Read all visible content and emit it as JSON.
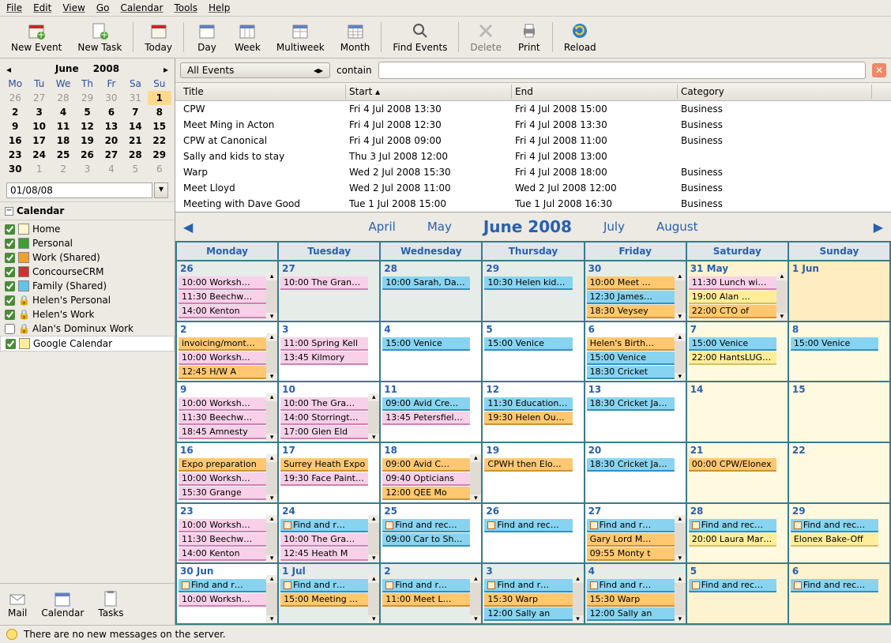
{
  "menu": [
    "File",
    "Edit",
    "View",
    "Go",
    "Calendar",
    "Tools",
    "Help"
  ],
  "toolbar": [
    {
      "id": "new-event",
      "label": "New Event"
    },
    {
      "id": "new-task",
      "label": "New Task"
    },
    {
      "sep": true
    },
    {
      "id": "today",
      "label": "Today"
    },
    {
      "sep": true
    },
    {
      "id": "day",
      "label": "Day"
    },
    {
      "id": "week",
      "label": "Week"
    },
    {
      "id": "multiweek",
      "label": "Multiweek"
    },
    {
      "id": "month",
      "label": "Month"
    },
    {
      "sep": true
    },
    {
      "id": "find-events",
      "label": "Find Events"
    },
    {
      "sep": true
    },
    {
      "id": "delete",
      "label": "Delete",
      "disabled": true
    },
    {
      "id": "print",
      "label": "Print"
    },
    {
      "sep": true
    },
    {
      "id": "reload",
      "label": "Reload"
    }
  ],
  "minical": {
    "month": "June",
    "year": "2008",
    "dow": [
      "Mo",
      "Tu",
      "We",
      "Th",
      "Fr",
      "Sa",
      "Su"
    ],
    "days": [
      [
        26,
        1
      ],
      [
        27,
        1
      ],
      [
        28,
        1
      ],
      [
        29,
        1
      ],
      [
        30,
        1
      ],
      [
        31,
        1
      ],
      [
        1,
        2
      ],
      [
        2,
        0
      ],
      [
        3,
        0
      ],
      [
        4,
        0
      ],
      [
        5,
        0
      ],
      [
        6,
        0
      ],
      [
        7,
        0
      ],
      [
        8,
        0
      ],
      [
        9,
        0
      ],
      [
        10,
        0
      ],
      [
        11,
        0
      ],
      [
        12,
        0
      ],
      [
        13,
        0
      ],
      [
        14,
        0
      ],
      [
        15,
        0
      ],
      [
        16,
        0
      ],
      [
        17,
        0
      ],
      [
        18,
        0
      ],
      [
        19,
        0
      ],
      [
        20,
        0
      ],
      [
        21,
        0
      ],
      [
        22,
        0
      ],
      [
        23,
        0
      ],
      [
        24,
        0
      ],
      [
        25,
        0
      ],
      [
        26,
        0
      ],
      [
        27,
        0
      ],
      [
        28,
        0
      ],
      [
        29,
        0
      ],
      [
        30,
        0
      ],
      [
        1,
        1
      ],
      [
        2,
        1
      ],
      [
        3,
        1
      ],
      [
        4,
        1
      ],
      [
        5,
        1
      ],
      [
        6,
        1
      ]
    ],
    "date_input": "01/08/08"
  },
  "cal_section": "Calendar",
  "calendars": [
    {
      "name": "Home",
      "color": "#fff6cc",
      "checked": true
    },
    {
      "name": "Personal",
      "color": "#3aa030",
      "checked": true
    },
    {
      "name": "Work (Shared)",
      "color": "#f0a030",
      "checked": true
    },
    {
      "name": "ConcourseCRM",
      "color": "#d03030",
      "checked": true
    },
    {
      "name": "Family (Shared)",
      "color": "#60c4e8",
      "checked": true
    },
    {
      "name": "Helen's Personal",
      "color": "lock",
      "checked": true
    },
    {
      "name": "Helen's Work",
      "color": "lock",
      "checked": true
    },
    {
      "name": "Alan's Dominux Work",
      "color": "lock",
      "checked": false
    },
    {
      "name": "Google Calendar",
      "color": "#ffee99",
      "checked": true,
      "sel": true
    }
  ],
  "side_buttons": [
    "Mail",
    "Calendar",
    "Tasks"
  ],
  "search": {
    "combo": "All Events",
    "label": "contain",
    "value": ""
  },
  "list_head": [
    "Title",
    "Start",
    "End",
    "Category"
  ],
  "events": [
    {
      "t": "CPW",
      "s": "Fri 4 Jul 2008 13:30",
      "e": "Fri 4 Jul 2008 15:00",
      "c": "Business"
    },
    {
      "t": "Meet Ming in Acton",
      "s": "Fri 4 Jul 2008 12:30",
      "e": "Fri 4 Jul 2008 13:30",
      "c": "Business"
    },
    {
      "t": "CPW at Canonical",
      "s": "Fri 4 Jul 2008 09:00",
      "e": "Fri 4 Jul 2008 11:00",
      "c": "Business"
    },
    {
      "t": "Sally and kids to stay",
      "s": "Thu 3 Jul 2008 12:00",
      "e": "Fri 4 Jul 2008 13:00",
      "c": ""
    },
    {
      "t": "Warp",
      "s": "Wed 2 Jul 2008 15:30",
      "e": "Fri 4 Jul 2008 18:00",
      "c": "Business"
    },
    {
      "t": "Meet Lloyd",
      "s": "Wed 2 Jul 2008 11:00",
      "e": "Wed 2 Jul 2008 12:00",
      "c": "Business"
    },
    {
      "t": "Meeting with Dave Good",
      "s": "Tue 1 Jul 2008 15:00",
      "e": "Tue 1 Jul 2008 16:30",
      "c": "Business"
    }
  ],
  "nav_months": [
    "April",
    "May",
    "June 2008",
    "July",
    "August"
  ],
  "dow": [
    "Monday",
    "Tuesday",
    "Wednesday",
    "Thursday",
    "Friday",
    "Saturday",
    "Sunday"
  ],
  "grid": [
    [
      {
        "d": "26",
        "dim": 1,
        "sc": 1,
        "ev": [
          {
            "c": "pink",
            "t": "10:00 Worksh…"
          },
          {
            "c": "pink",
            "t": "11:30 Beechw…"
          },
          {
            "c": "pink",
            "t": "14:00 Kenton"
          }
        ]
      },
      {
        "d": "27",
        "dim": 1,
        "ev": [
          {
            "c": "pink",
            "t": "10:00 The Grang…"
          }
        ]
      },
      {
        "d": "28",
        "dim": 1,
        "ev": [
          {
            "c": "blue",
            "t": "10:00 Sarah, Dav…"
          }
        ]
      },
      {
        "d": "29",
        "dim": 1,
        "ev": [
          {
            "c": "blue",
            "t": "10:30 Helen kids …"
          }
        ]
      },
      {
        "d": "30",
        "dim": 1,
        "sc": 1,
        "ev": [
          {
            "c": "orange",
            "t": "10:00 Meet …"
          },
          {
            "c": "blue",
            "t": "12:30 James…"
          },
          {
            "c": "orange",
            "t": "18:30 Veysey"
          }
        ]
      },
      {
        "d": "31 May",
        "dim": 1,
        "we": 1,
        "sc": 1,
        "ev": [
          {
            "c": "pink",
            "t": "11:30 Lunch wi…"
          },
          {
            "c": "yellow",
            "t": "19:00 Alan …"
          },
          {
            "c": "orange",
            "t": "22:00 CTO of"
          }
        ]
      },
      {
        "d": "1 Jun",
        "we": 1,
        "today": 1,
        "ev": []
      }
    ],
    [
      {
        "d": "2",
        "sc": 1,
        "ev": [
          {
            "c": "orange",
            "t": "invoicing/mont…"
          },
          {
            "c": "pink",
            "t": "10:00 Worksh…"
          },
          {
            "c": "orange",
            "t": "12:45 H/W A"
          }
        ]
      },
      {
        "d": "3",
        "ev": [
          {
            "c": "pink",
            "t": "11:00 Spring Kell"
          },
          {
            "c": "pink",
            "t": "13:45 Kilmory"
          }
        ]
      },
      {
        "d": "4",
        "ev": [
          {
            "c": "blue",
            "t": "15:00 Venice"
          }
        ]
      },
      {
        "d": "5",
        "ev": [
          {
            "c": "blue",
            "t": "15:00 Venice"
          }
        ]
      },
      {
        "d": "6",
        "sc": 1,
        "ev": [
          {
            "c": "orange",
            "t": "Helen's Birth…"
          },
          {
            "c": "blue",
            "t": "15:00 Venice"
          },
          {
            "c": "blue",
            "t": "18:30 Cricket"
          }
        ]
      },
      {
        "d": "7",
        "we": 1,
        "ev": [
          {
            "c": "blue",
            "t": "15:00 Venice"
          },
          {
            "c": "yellow",
            "t": "22:00 HantsLUG …"
          }
        ]
      },
      {
        "d": "8",
        "we": 1,
        "ev": [
          {
            "c": "blue",
            "t": "15:00 Venice"
          }
        ]
      }
    ],
    [
      {
        "d": "9",
        "sc": 1,
        "ev": [
          {
            "c": "pink",
            "t": "10:00 Worksh…"
          },
          {
            "c": "pink",
            "t": "11:30 Beechw…"
          },
          {
            "c": "pink",
            "t": "18:45 Amnesty"
          }
        ]
      },
      {
        "d": "10",
        "sc": 1,
        "ev": [
          {
            "c": "pink",
            "t": "10:00 The Gra…"
          },
          {
            "c": "pink",
            "t": "14:00 Storringt…"
          },
          {
            "c": "pink",
            "t": "17:00 Glen Eld"
          }
        ]
      },
      {
        "d": "11",
        "ev": [
          {
            "c": "blue",
            "t": "09:00 Avid Cre…"
          },
          {
            "c": "pink",
            "t": "13:45 Petersfield…"
          }
        ]
      },
      {
        "d": "12",
        "ev": [
          {
            "c": "blue",
            "t": "11:30 Education …"
          },
          {
            "c": "orange",
            "t": "19:30 Helen Ou…"
          }
        ]
      },
      {
        "d": "13",
        "ev": [
          {
            "c": "blue",
            "t": "18:30 Cricket Ja…"
          }
        ]
      },
      {
        "d": "14",
        "we": 1,
        "ev": []
      },
      {
        "d": "15",
        "we": 1,
        "ev": []
      }
    ],
    [
      {
        "d": "16",
        "sc": 1,
        "ev": [
          {
            "c": "orange",
            "t": "Expo preparation"
          },
          {
            "c": "pink",
            "t": "10:00 Worksh…"
          },
          {
            "c": "pink",
            "t": "15:30 Grange"
          }
        ]
      },
      {
        "d": "17",
        "ev": [
          {
            "c": "orange",
            "t": "Surrey Heath Expo"
          },
          {
            "c": "pink",
            "t": "19:30 Face Paint…"
          }
        ]
      },
      {
        "d": "18",
        "sc": 1,
        "ev": [
          {
            "c": "orange",
            "t": "09:00 Avid C…"
          },
          {
            "c": "pink",
            "t": "09:40 Opticians"
          },
          {
            "c": "orange",
            "t": "12:00 QEE Mo"
          }
        ]
      },
      {
        "d": "19",
        "ev": [
          {
            "c": "orange",
            "t": "CPWH then Elo…"
          }
        ]
      },
      {
        "d": "20",
        "ev": [
          {
            "c": "blue",
            "t": "18:30 Cricket Ja…"
          }
        ]
      },
      {
        "d": "21",
        "we": 1,
        "ev": [
          {
            "c": "orange",
            "t": "00:00 CPW/Elonex"
          }
        ]
      },
      {
        "d": "22",
        "we": 1,
        "ev": []
      }
    ],
    [
      {
        "d": "23",
        "sc": 1,
        "ev": [
          {
            "c": "pink",
            "t": "10:00 Worksh…"
          },
          {
            "c": "pink",
            "t": "11:30 Beechw…"
          },
          {
            "c": "pink",
            "t": "14:00 Kenton"
          }
        ]
      },
      {
        "d": "24",
        "sc": 1,
        "ev": [
          {
            "c": "blue",
            "t": "Find and r…",
            "r": 1
          },
          {
            "c": "pink",
            "t": "10:00 The Gra…"
          },
          {
            "c": "pink",
            "t": "12:45 Heath M"
          }
        ]
      },
      {
        "d": "25",
        "ev": [
          {
            "c": "blue",
            "t": "Find and rec…",
            "r": 1
          },
          {
            "c": "blue",
            "t": "09:00 Car to Sho…"
          }
        ]
      },
      {
        "d": "26",
        "ev": [
          {
            "c": "blue",
            "t": "Find and rec…",
            "r": 1
          }
        ]
      },
      {
        "d": "27",
        "sc": 1,
        "ev": [
          {
            "c": "blue",
            "t": "Find and r…",
            "r": 1
          },
          {
            "c": "orange",
            "t": "Gary Lord M…"
          },
          {
            "c": "orange",
            "t": "09:55 Monty t"
          }
        ]
      },
      {
        "d": "28",
        "we": 1,
        "ev": [
          {
            "c": "blue",
            "t": "Find and rec…",
            "r": 1
          },
          {
            "c": "yellow",
            "t": "20:00 Laura Mark…"
          }
        ]
      },
      {
        "d": "29",
        "we": 1,
        "ev": [
          {
            "c": "blue",
            "t": "Find and rec…",
            "r": 1
          },
          {
            "c": "yellow",
            "t": "Elonex Bake-Off"
          }
        ]
      }
    ],
    [
      {
        "d": "30 Jun",
        "sc": 1,
        "ev": [
          {
            "c": "blue",
            "t": "Find and r…",
            "r": 1
          },
          {
            "c": "pink",
            "t": "10:00 Worksh…"
          }
        ]
      },
      {
        "d": "1 Jul",
        "dim": 1,
        "sc": 1,
        "ev": [
          {
            "c": "blue",
            "t": "Find and r…",
            "r": 1
          },
          {
            "c": "orange",
            "t": "15:00 Meeting …"
          }
        ]
      },
      {
        "d": "2",
        "dim": 1,
        "sc": 1,
        "ev": [
          {
            "c": "blue",
            "t": "Find and r…",
            "r": 1
          },
          {
            "c": "orange",
            "t": "11:00 Meet L…"
          }
        ]
      },
      {
        "d": "3",
        "dim": 1,
        "sc": 1,
        "ev": [
          {
            "c": "blue",
            "t": "Find and r…",
            "r": 1
          },
          {
            "c": "orange",
            "t": "15:30 Warp"
          },
          {
            "c": "blue",
            "t": "12:00 Sally an"
          }
        ]
      },
      {
        "d": "4",
        "dim": 1,
        "sc": 1,
        "ev": [
          {
            "c": "blue",
            "t": "Find and r…",
            "r": 1
          },
          {
            "c": "orange",
            "t": "15:30 Warp"
          },
          {
            "c": "blue",
            "t": "12:00 Sally an"
          }
        ]
      },
      {
        "d": "5",
        "dim": 1,
        "we": 1,
        "ev": [
          {
            "c": "blue",
            "t": "Find and rec…",
            "r": 1
          }
        ]
      },
      {
        "d": "6",
        "dim": 1,
        "we": 1,
        "ev": [
          {
            "c": "blue",
            "t": "Find and rec…",
            "r": 1
          }
        ]
      }
    ]
  ],
  "status": "There are no new messages on the server."
}
